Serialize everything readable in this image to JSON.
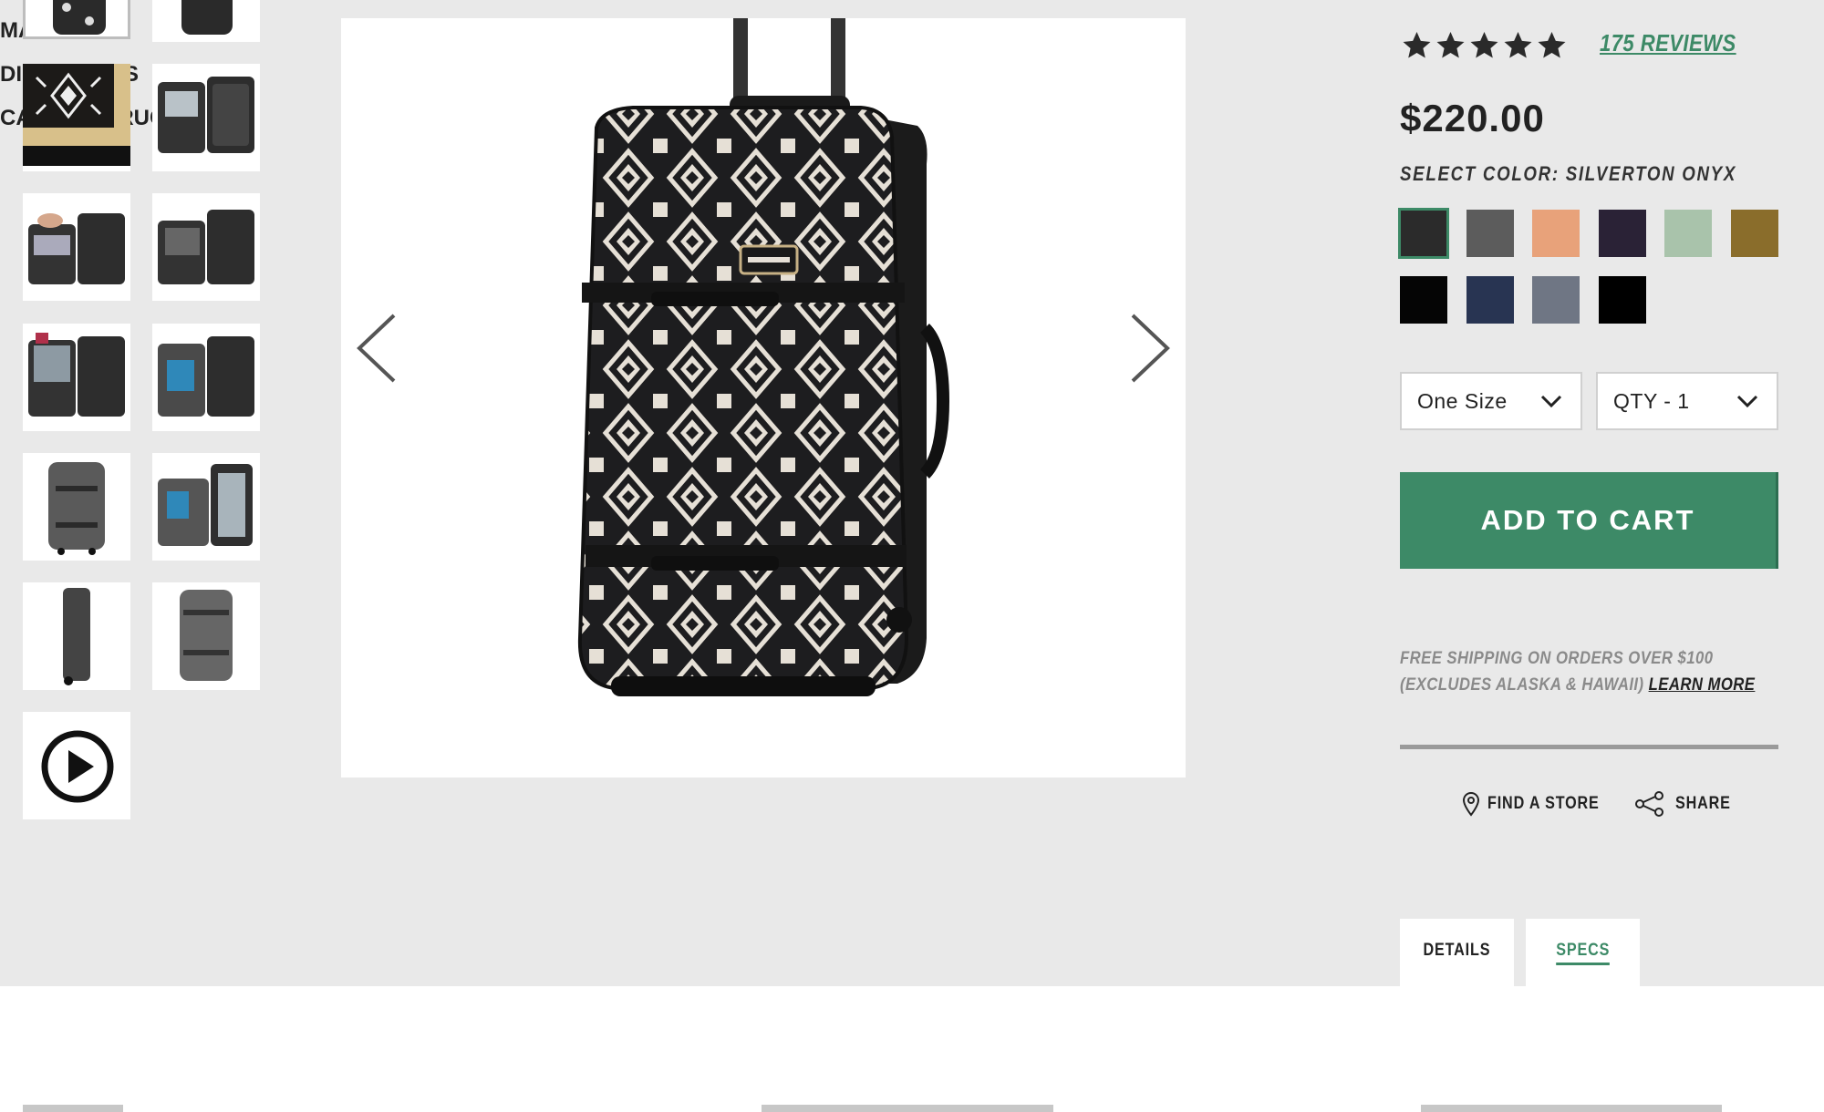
{
  "thumbnails": [
    {
      "name": "thumb-bag-front-active",
      "active": true
    },
    {
      "name": "thumb-bag-back"
    },
    {
      "name": "thumb-pattern-swatch"
    },
    {
      "name": "thumb-open-interior"
    },
    {
      "name": "thumb-packing-hands"
    },
    {
      "name": "thumb-open-packed"
    },
    {
      "name": "thumb-open-red"
    },
    {
      "name": "thumb-open-blue"
    },
    {
      "name": "thumb-grey-front"
    },
    {
      "name": "thumb-grey-open"
    },
    {
      "name": "thumb-side-view"
    },
    {
      "name": "thumb-grey-side"
    },
    {
      "name": "thumb-video-play"
    }
  ],
  "product": {
    "rating": 5,
    "reviews_label": "175 REVIEWS",
    "price": "$220.00",
    "select_color_label": "SELECT COLOR: SILVERTON ONYX",
    "colors": [
      {
        "name": "Silverton Onyx",
        "hex": "#2b2b2b",
        "selected": true
      },
      {
        "name": "Grey stripe",
        "hex": "#5c5c5c"
      },
      {
        "name": "Peach",
        "hex": "#e8a27a"
      },
      {
        "name": "Floral dark",
        "hex": "#2a2236"
      },
      {
        "name": "Sage",
        "hex": "#a9c3ab"
      },
      {
        "name": "Olive",
        "hex": "#8a6d2b"
      },
      {
        "name": "Black",
        "hex": "#050505"
      },
      {
        "name": "Navy",
        "hex": "#283452"
      },
      {
        "name": "Heather",
        "hex": "#6f7684"
      },
      {
        "name": "Black 2",
        "hex": "#000000"
      }
    ],
    "size_value": "One Size",
    "qty_value": "QTY - 1",
    "add_to_cart": "ADD TO CART",
    "shipping_text": "FREE SHIPPING ON ORDERS OVER $100 (EXCLUDES ALASKA & HAWAII)",
    "learn_more": "LEARN MORE",
    "find_store": "FIND A STORE",
    "share": "SHARE"
  },
  "tabs": {
    "details": "DETAILS",
    "specs": "SPECS"
  },
  "sections": {
    "materials": "MATERIALS",
    "dimensions": "DIMENSIONS",
    "care": "CARE INSTRUCTIONS"
  },
  "colors": {
    "accent": "#3d8a67",
    "page_bg": "#e9e9e9"
  }
}
